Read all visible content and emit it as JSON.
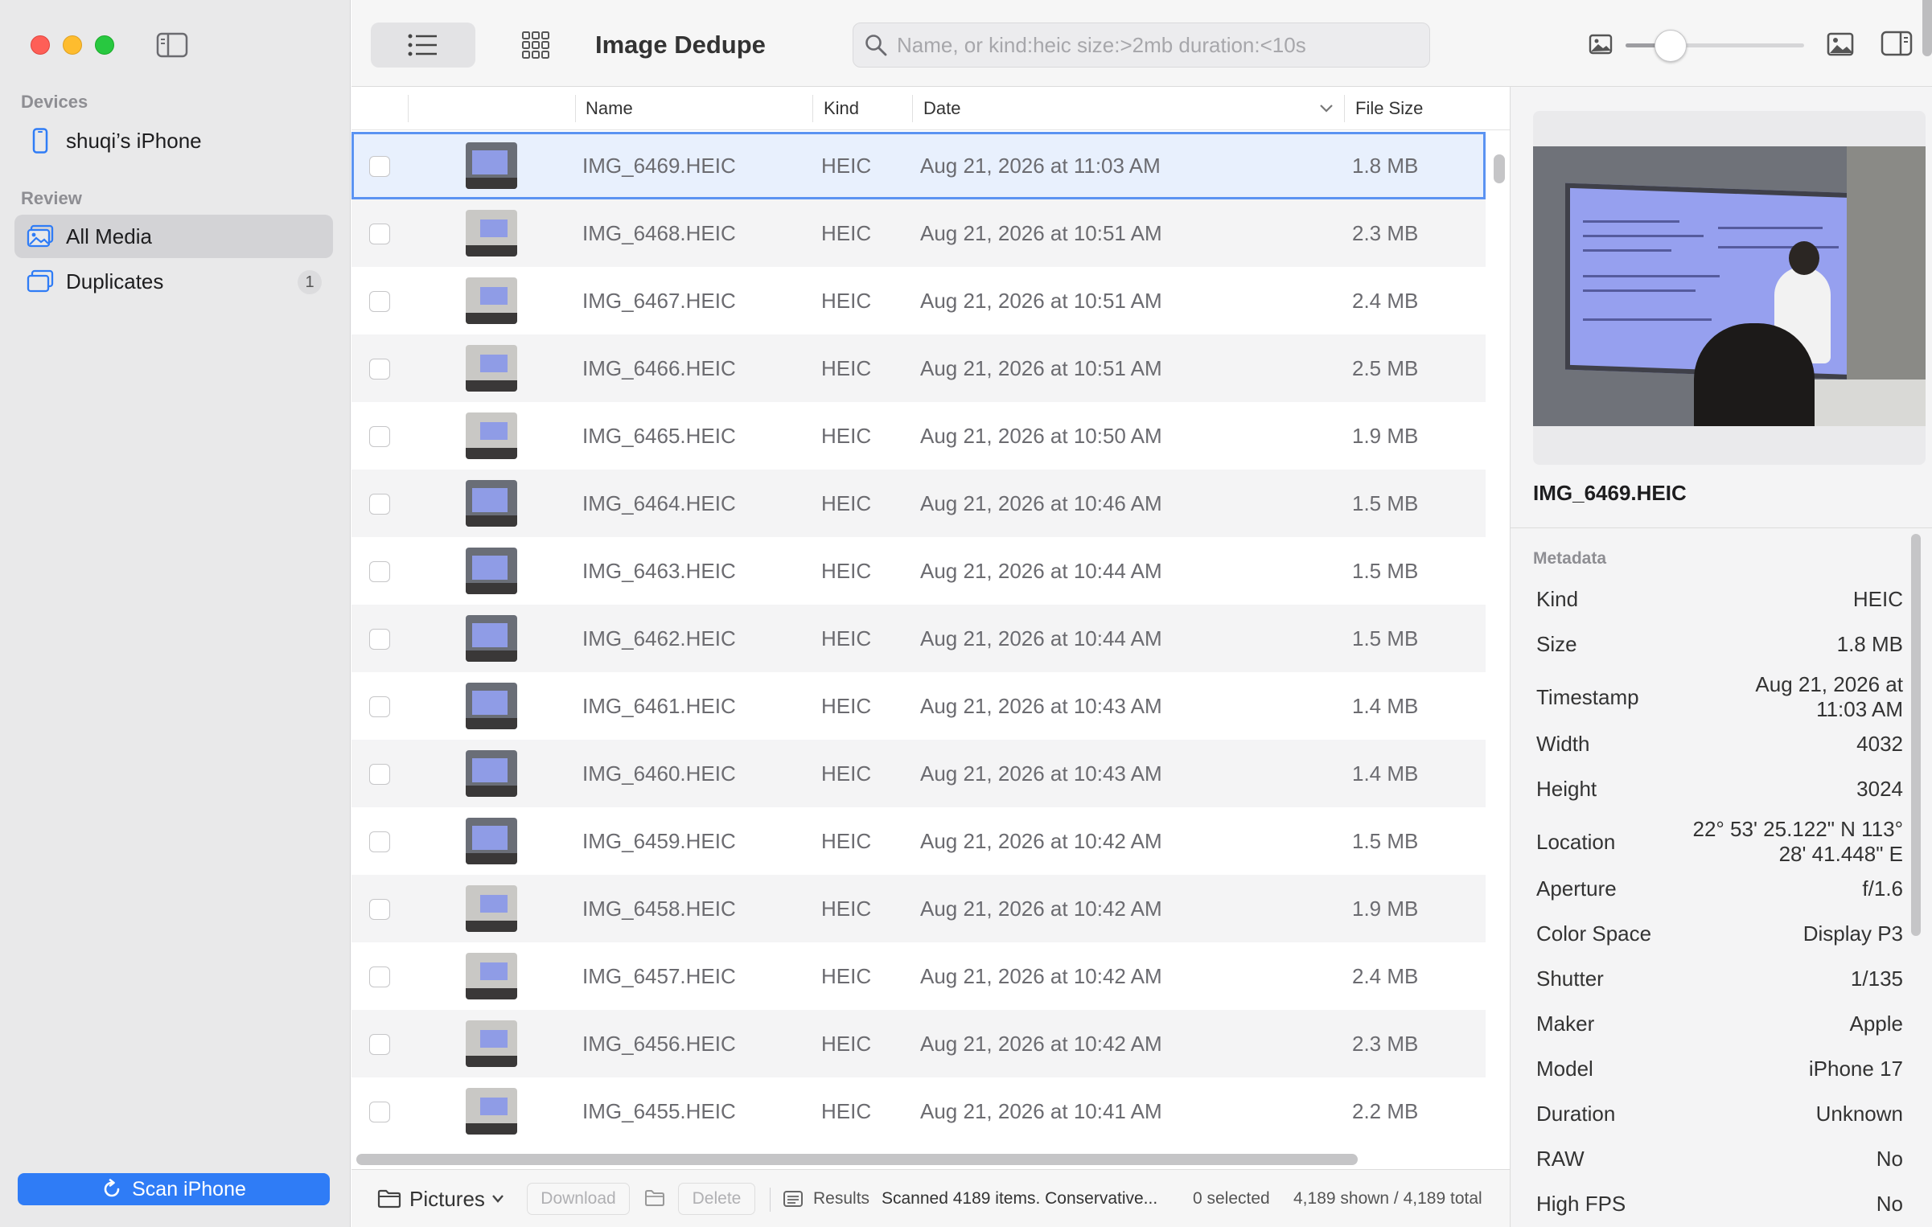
{
  "sidebar": {
    "devices_label": "Devices",
    "device_name": "shuqi’s iPhone",
    "review_label": "Review",
    "items": [
      {
        "label": "All Media",
        "active": true
      },
      {
        "label": "Duplicates",
        "badge": "1"
      }
    ],
    "scan_button": "Scan iPhone"
  },
  "toolbar": {
    "title": "Image Dedupe",
    "search_placeholder": "Name, or kind:heic size:>2mb duration:<10s",
    "thumbnail_size": 0.25
  },
  "table": {
    "columns": [
      "Name",
      "Kind",
      "Date",
      "File Size"
    ],
    "rows": [
      {
        "name": "IMG_6469.HEIC",
        "kind": "HEIC",
        "date": "Aug 21, 2026 at 11:03 AM",
        "size": "1.8 MB",
        "selected": true
      },
      {
        "name": "IMG_6468.HEIC",
        "kind": "HEIC",
        "date": "Aug 21, 2026 at 10:51 AM",
        "size": "2.3 MB"
      },
      {
        "name": "IMG_6467.HEIC",
        "kind": "HEIC",
        "date": "Aug 21, 2026 at 10:51 AM",
        "size": "2.4 MB"
      },
      {
        "name": "IMG_6466.HEIC",
        "kind": "HEIC",
        "date": "Aug 21, 2026 at 10:51 AM",
        "size": "2.5 MB"
      },
      {
        "name": "IMG_6465.HEIC",
        "kind": "HEIC",
        "date": "Aug 21, 2026 at 10:50 AM",
        "size": "1.9 MB"
      },
      {
        "name": "IMG_6464.HEIC",
        "kind": "HEIC",
        "date": "Aug 21, 2026 at 10:46 AM",
        "size": "1.5 MB"
      },
      {
        "name": "IMG_6463.HEIC",
        "kind": "HEIC",
        "date": "Aug 21, 2026 at 10:44 AM",
        "size": "1.5 MB"
      },
      {
        "name": "IMG_6462.HEIC",
        "kind": "HEIC",
        "date": "Aug 21, 2026 at 10:44 AM",
        "size": "1.5 MB"
      },
      {
        "name": "IMG_6461.HEIC",
        "kind": "HEIC",
        "date": "Aug 21, 2026 at 10:43 AM",
        "size": "1.4 MB"
      },
      {
        "name": "IMG_6460.HEIC",
        "kind": "HEIC",
        "date": "Aug 21, 2026 at 10:43 AM",
        "size": "1.4 MB"
      },
      {
        "name": "IMG_6459.HEIC",
        "kind": "HEIC",
        "date": "Aug 21, 2026 at 10:42 AM",
        "size": "1.5 MB"
      },
      {
        "name": "IMG_6458.HEIC",
        "kind": "HEIC",
        "date": "Aug 21, 2026 at 10:42 AM",
        "size": "1.9 MB"
      },
      {
        "name": "IMG_6457.HEIC",
        "kind": "HEIC",
        "date": "Aug 21, 2026 at 10:42 AM",
        "size": "2.4 MB"
      },
      {
        "name": "IMG_6456.HEIC",
        "kind": "HEIC",
        "date": "Aug 21, 2026 at 10:42 AM",
        "size": "2.3 MB"
      },
      {
        "name": "IMG_6455.HEIC",
        "kind": "HEIC",
        "date": "Aug 21, 2026 at 10:41 AM",
        "size": "2.2 MB"
      }
    ]
  },
  "bottombar": {
    "folder": "Pictures",
    "download": "Download",
    "delete": "Delete",
    "results_label": "Results",
    "status": "Scanned 4189 items. Conservative...",
    "selected": "0 selected",
    "shown": "4,189 shown / 4,189 total"
  },
  "inspector": {
    "filename": "IMG_6469.HEIC",
    "metadata_label": "Metadata",
    "metadata": [
      {
        "key": "Kind",
        "value": "HEIC"
      },
      {
        "key": "Size",
        "value": "1.8 MB"
      },
      {
        "key": "Timestamp",
        "value": "Aug 21, 2026 at\n11:03 AM"
      },
      {
        "key": "Width",
        "value": "4032"
      },
      {
        "key": "Height",
        "value": "3024"
      },
      {
        "key": "Location",
        "value": "22° 53' 25.122\" N 113°\n28' 41.448\" E"
      },
      {
        "key": "Aperture",
        "value": "f/1.6"
      },
      {
        "key": "Color Space",
        "value": "Display P3"
      },
      {
        "key": "Shutter",
        "value": "1/135"
      },
      {
        "key": "Maker",
        "value": "Apple"
      },
      {
        "key": "Model",
        "value": "iPhone 17"
      },
      {
        "key": "Duration",
        "value": "Unknown"
      },
      {
        "key": "RAW",
        "value": "No"
      },
      {
        "key": "High FPS",
        "value": "No"
      }
    ]
  },
  "colors": {
    "accent": "#2f7cf6",
    "selection_outline": "#5b93f2",
    "sidebar_bg": "#e9e9ea"
  },
  "icons": [
    "sidebar-toggle-icon",
    "iphone-icon",
    "photo-library-icon",
    "duplicates-icon",
    "refresh-icon",
    "list-view-icon",
    "grid-view-icon",
    "search-icon",
    "small-image-icon",
    "large-image-icon",
    "inspector-toggle-icon",
    "folder-icon",
    "chevron-down-icon",
    "results-icon"
  ]
}
